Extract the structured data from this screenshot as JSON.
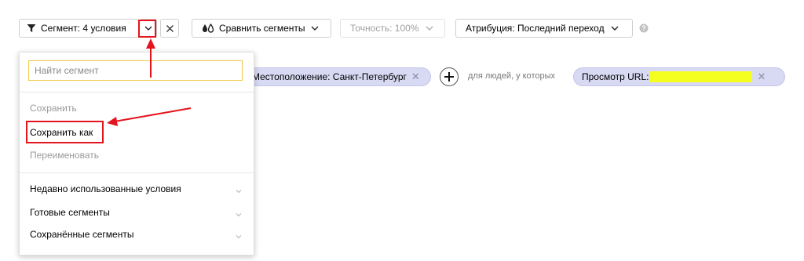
{
  "toolbar": {
    "segment_label": "Сегмент: 4 условия",
    "compare_label": "Сравнить сегменты",
    "accuracy_label": "Точность: 100%",
    "attribution_label": "Атрибуция: Последний переход"
  },
  "filters": {
    "location_pill": "Местоположение: Санкт-Петербург",
    "people_label": "для людей, у которых",
    "url_pill": "Просмотр URL:"
  },
  "dropdown": {
    "search_placeholder": "Найти сегмент",
    "actions": [
      "Сохранить",
      "Сохранить как",
      "Переименовать"
    ],
    "groups": [
      "Недавно использованные условия",
      "Готовые сегменты",
      "Сохранённые сегменты"
    ]
  },
  "colors": {
    "pill_bg": "#d8d9f3",
    "search_border": "#f0c94a",
    "annotation_red": "#e3141c",
    "highlight_yellow": "#f5ff1f"
  }
}
